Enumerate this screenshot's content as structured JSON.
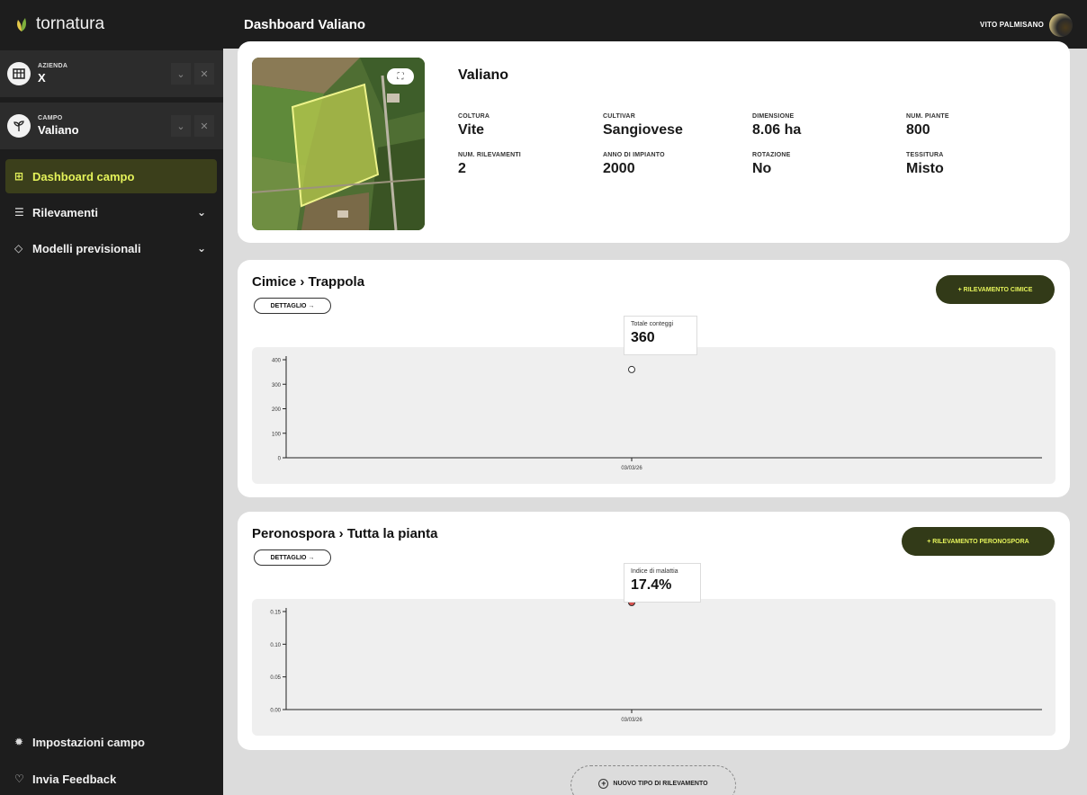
{
  "app": {
    "brand": "tornatura"
  },
  "header": {
    "title": "Dashboard Valiano",
    "user": "VITO PALMISANO"
  },
  "sidebar": {
    "azienda": {
      "label": "AZIENDA",
      "value": "X"
    },
    "campo": {
      "label": "CAMPO",
      "value": "Valiano"
    },
    "nav": [
      {
        "label": "Dashboard campo",
        "icon": "grid-icon",
        "active": true
      },
      {
        "label": "Rilevamenti",
        "icon": "list-icon"
      },
      {
        "label": "Modelli previsionali",
        "icon": "diamond-icon"
      }
    ],
    "footer": [
      {
        "label": "Impostazioni campo",
        "icon": "gear-icon"
      },
      {
        "label": "Invia Feedback",
        "icon": "chat-icon"
      }
    ]
  },
  "field": {
    "name": "Valiano",
    "attributes": [
      {
        "key": "COLTURA",
        "value": "Vite"
      },
      {
        "key": "CULTIVAR",
        "value": "Sangiovese"
      },
      {
        "key": "DIMENSIONE",
        "value": "8.06 ha"
      },
      {
        "key": "NUM. PIANTE",
        "value": "800"
      },
      {
        "key": "NUM. RILEVAMENTI",
        "value": "2"
      },
      {
        "key": "ANNO DI IMPIANTO",
        "value": "2000"
      },
      {
        "key": "ROTAZIONE",
        "value": "No"
      },
      {
        "key": "TESSITURA",
        "value": "Misto"
      }
    ]
  },
  "cards": [
    {
      "title": "Cimice › Trappola",
      "detail": "DETTAGLIO →",
      "action": "+ RILEVAMENTO CIMICE",
      "tooltip": {
        "label": "Totale conteggi",
        "value": "360"
      }
    },
    {
      "title": "Peronospora › Tutta la pianta",
      "detail": "DETTAGLIO →",
      "action": "+ RILEVAMENTO PERONOSPORA",
      "tooltip": {
        "label": "Indice di malattia",
        "value": "17.4%"
      }
    }
  ],
  "chart_data": [
    {
      "type": "scatter",
      "x": [
        "03/03/26"
      ],
      "y": [
        360
      ],
      "yticks": [
        "0",
        "100",
        "200",
        "300",
        "400"
      ],
      "ylim": [
        0,
        400
      ],
      "marker_color": "#ffffff"
    },
    {
      "type": "scatter",
      "x": [
        "03/03/26"
      ],
      "y": [
        0.174
      ],
      "yticks": [
        "0.00",
        "0.05",
        "0.10",
        "0.15"
      ],
      "ylim": [
        0,
        0.15
      ],
      "marker_color": "#d9534f"
    }
  ],
  "footer_action": "NUOVO TIPO DI RILEVAMENTO"
}
